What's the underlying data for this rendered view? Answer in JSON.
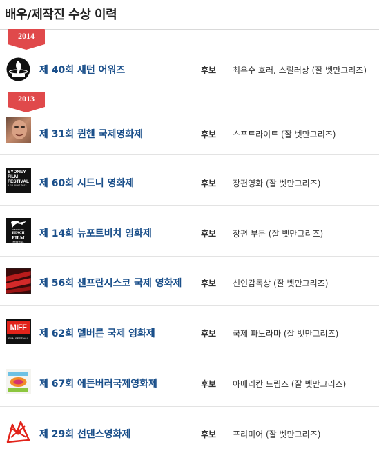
{
  "header": {
    "title": "배우/제작진 수상 이력"
  },
  "years": [
    {
      "label": "2014"
    },
    {
      "label": "2013"
    }
  ],
  "entries": [
    {
      "logo": "saturn-awards-logo",
      "title": "제 40회 새턴 어워즈",
      "status": "후보",
      "award": "최우수 호러, 스릴러상 (잘 벳만그리즈)"
    },
    {
      "logo": "munich-film-festival-logo",
      "title": "제 31회 뮌헨 국제영화제",
      "status": "후보",
      "award": "스포트라이트 (잘 벳만그리즈)"
    },
    {
      "logo": "sydney-film-festival-logo",
      "logo_text": [
        "SYDNEY",
        "FILM",
        "FESTIVAL",
        "5–16 JUNE 2013"
      ],
      "title": "제 60회 시드니 영화제",
      "status": "후보",
      "award": "장편영화 (잘 벳만그리즈)"
    },
    {
      "logo": "newport-beach-film-festival-logo",
      "logo_text": [
        "NEWPORT",
        "BEACH",
        "FILM",
        "FESTIVAL"
      ],
      "title": "제 14회 뉴포트비치 영화제",
      "status": "후보",
      "award": "장편 부문 (잘 벳만그리즈)"
    },
    {
      "logo": "san-francisco-film-festival-logo",
      "title": "제 56회 샌프란시스코 국제 영화제",
      "status": "후보",
      "award": "신인감독상 (잘 벳만그리즈)"
    },
    {
      "logo": "melbourne-film-festival-logo",
      "logo_text": [
        "MIFF",
        "FILM FESTIVAL"
      ],
      "title": "제 62회 멜버른 국제 영화제",
      "status": "후보",
      "award": "국제 파노라마 (잘 벳만그리즈)"
    },
    {
      "logo": "edinburgh-film-festival-logo",
      "title": "제 67회 에든버러국제영화제",
      "status": "후보",
      "award": "아메리칸 드림즈 (잘 벳만그리즈)"
    },
    {
      "logo": "sundance-film-festival-logo",
      "title": "제 29회 선댄스영화제",
      "status": "후보",
      "award": "프리미어 (잘 벳만그리즈)"
    }
  ]
}
